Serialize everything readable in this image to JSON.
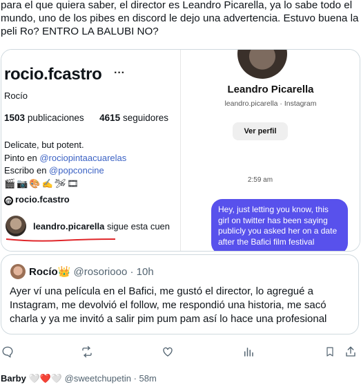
{
  "tweet": {
    "text": "para el que quiera saber, el director es Leandro Picarella, ya lo sabe todo el mundo, uno de los pibes en discord le dejo una advertencia. Estuvo buena la peli Ro? ENTRO LA BALUBI NO?"
  },
  "media": {
    "profile": {
      "handle": "rocio.fcastro",
      "more": "···",
      "name": "Rocío",
      "posts_count": "1503",
      "posts_label": "publicaciones",
      "followers_count": "4615",
      "followers_label": "seguidores",
      "bio_line1": "Delicate, but potent.",
      "bio_line2_prefix": "Pinto en",
      "bio_line2_link": "@rociopintaacuarelas",
      "bio_line3_prefix": "Escribo en",
      "bio_line3_link": "@popconcine",
      "bio_emojis": "🎬📷🎨✍🛩🎞",
      "threads_handle": "rocio.fcastro",
      "follower_user": "leandro.picarella",
      "follower_text": "sigue esta cuen"
    },
    "dm": {
      "name": "Leandro Picarella",
      "sub": "leandro.picarella · Instagram",
      "view_profile": "Ver perfil",
      "time": "2:59 am",
      "message": "Hey, just letting you know, this girl on twitter has been saying publicly you asked her on a date after the Bafici film festival"
    }
  },
  "quote": {
    "name": "Rocío",
    "crown": "👑",
    "handle": "@rosoriooo",
    "time": "· 10h",
    "text": "Ayer ví una película en el Bafici, me gustó el director, lo agregué a Instagram, me devolvió el follow, me respondió una historia, me sacó charla y ya me invitó a salir pim pum pam así lo hace una profesional"
  },
  "next_tweet": {
    "name": "Barby",
    "badges": "🤍❤️🤍",
    "handle": "@sweetchupetin",
    "time": "· 58m"
  },
  "colors": {
    "accent": "#1d9bf0",
    "link": "#3b62c4",
    "bubble": "#5851ec",
    "underline": "#e0262a"
  }
}
